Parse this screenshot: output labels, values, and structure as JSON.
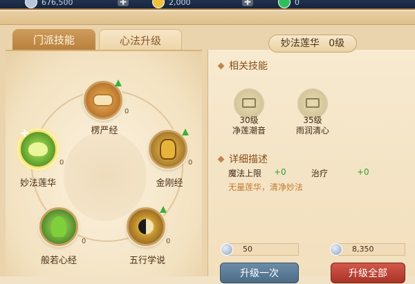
{
  "resources": [
    {
      "name": "silver",
      "value": "676,500",
      "color": "#b8c6dc"
    },
    {
      "name": "gold",
      "value": "2,000",
      "color": "#f0c13a"
    },
    {
      "name": "jade",
      "value": "0",
      "color": "#2fbf5a"
    }
  ],
  "tabs": [
    {
      "label": "门派技能",
      "active": true
    },
    {
      "label": "心法升级",
      "active": false
    }
  ],
  "skills": [
    {
      "name": "楞严经",
      "level": "0",
      "icon": "scroll-icon",
      "color": "#d08a2a"
    },
    {
      "name": "妙法莲华",
      "level": "0",
      "icon": "lotus-icon",
      "color": "#6fbf2a",
      "selected": true
    },
    {
      "name": "金刚经",
      "level": "0",
      "icon": "golden-mask-icon",
      "color": "#d4a23a"
    },
    {
      "name": "般若心经",
      "level": "0",
      "icon": "green-monk-icon",
      "color": "#5aa82a"
    },
    {
      "name": "五行学说",
      "level": "0",
      "icon": "yinyang-icon",
      "color": "#c98a2a"
    }
  ],
  "detail": {
    "title": "妙法莲华",
    "level": "0级",
    "related_title": "相关技能",
    "related": [
      {
        "level": "30级",
        "name": "净莲潮音"
      },
      {
        "level": "35级",
        "name": "雨润清心"
      }
    ],
    "desc_title": "详细描述",
    "stats": [
      {
        "label": "魔法上限",
        "value": "+0"
      },
      {
        "label": "治疗",
        "value": "+0"
      }
    ],
    "description": "无量莲华，清净妙法"
  },
  "costs": {
    "left": "50",
    "right": "8,350"
  },
  "buttons": {
    "upgrade_once": "升级一次",
    "upgrade_all": "升级全部"
  }
}
